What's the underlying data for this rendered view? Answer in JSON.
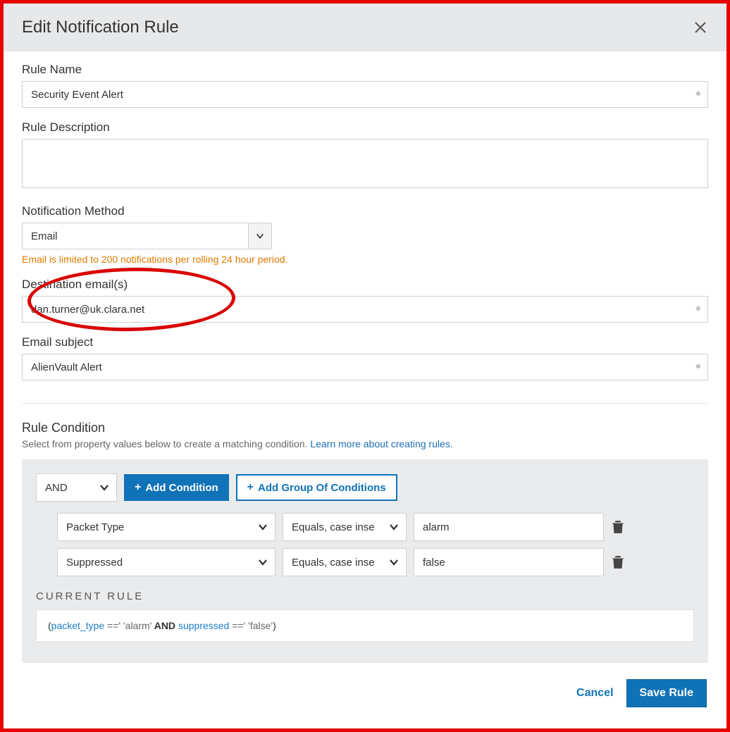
{
  "modal": {
    "title": "Edit Notification Rule",
    "close_icon": "close-icon"
  },
  "fields": {
    "rule_name": {
      "label": "Rule Name",
      "value": "Security Event Alert",
      "required": true
    },
    "rule_description": {
      "label": "Rule Description",
      "value": ""
    },
    "notification_method": {
      "label": "Notification Method",
      "selected": "Email",
      "helper": "Email is limited to 200 notifications per rolling 24 hour period."
    },
    "destination_emails": {
      "label": "Destination email(s)",
      "value": "dan.turner@uk.clara.net",
      "required": true
    },
    "email_subject": {
      "label": "Email subject",
      "value": "AlienVault Alert",
      "required": true
    }
  },
  "rule_condition": {
    "title": "Rule Condition",
    "subtitle_prefix": "Select from property values below to create a matching condition. ",
    "learn_more": "Learn more about creating rules.",
    "logic": "AND",
    "add_condition_label": "Add Condition",
    "add_group_label": "Add Group Of Conditions",
    "rows": [
      {
        "property": "Packet Type",
        "operator": "Equals, case inse",
        "value": "alarm"
      },
      {
        "property": "Suppressed",
        "operator": "Equals, case inse",
        "value": "false"
      }
    ],
    "current_rule_label": "CURRENT RULE",
    "preview": {
      "open": "(",
      "prop1": "packet_type",
      "eq": " ==' ",
      "val1": "'alarm'",
      "and": " AND ",
      "prop2": "suppressed",
      "val2": "'false'",
      "close": ")"
    }
  },
  "footer": {
    "cancel": "Cancel",
    "save": "Save Rule"
  }
}
